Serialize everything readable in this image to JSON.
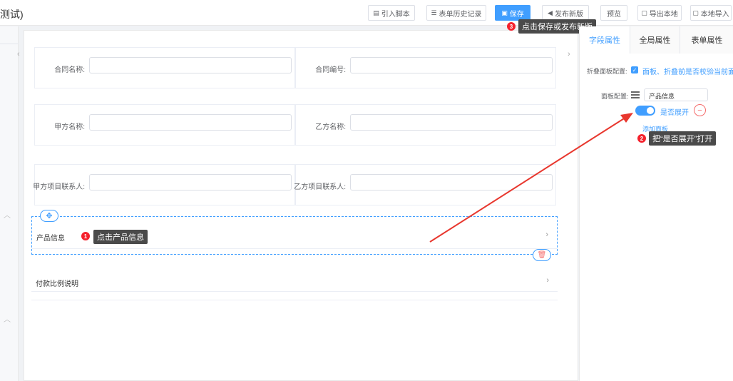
{
  "header": {
    "title": "测试)",
    "buttons": {
      "import_script": "引入脚本",
      "form_history": "表单历史记录",
      "save": "保存",
      "publish": "发布新版",
      "preview": "预览",
      "export_local": "导出本地",
      "import_local": "本地导入"
    }
  },
  "form": {
    "fields": {
      "contract_name": "合同名称:",
      "contract_no": "合同编号:",
      "party_a": "甲方名称:",
      "party_b": "乙方名称:",
      "party_a_contact": "甲方项目联系人:",
      "party_b_contact": "乙方项目联系人:"
    },
    "panels": {
      "product_info": "产品信息",
      "payment_ratio": "付款比例说明"
    }
  },
  "tips": {
    "step1": {
      "num": "1",
      "text": "点击产品信息"
    },
    "step2": {
      "num": "2",
      "text": "把“是否展开”打开"
    },
    "step3": {
      "num": "3",
      "text": "点击保存或发布新版"
    }
  },
  "right_panel": {
    "tabs": {
      "field_props": "字段属性",
      "global_props": "全局属性",
      "form_props": "表单属性"
    },
    "fold_config_label": "折叠面板配置:",
    "fold_config_text": "面板、折叠前是否校验当前面",
    "panel_config_label": "面板配置:",
    "panel_name_value": "产品信息",
    "expand_label": "是否展开",
    "expand_on": true,
    "add_panel": "添加面板"
  },
  "colors": {
    "accent": "#409eff",
    "badge": "#f5222d",
    "arrow": "#e8372e"
  }
}
